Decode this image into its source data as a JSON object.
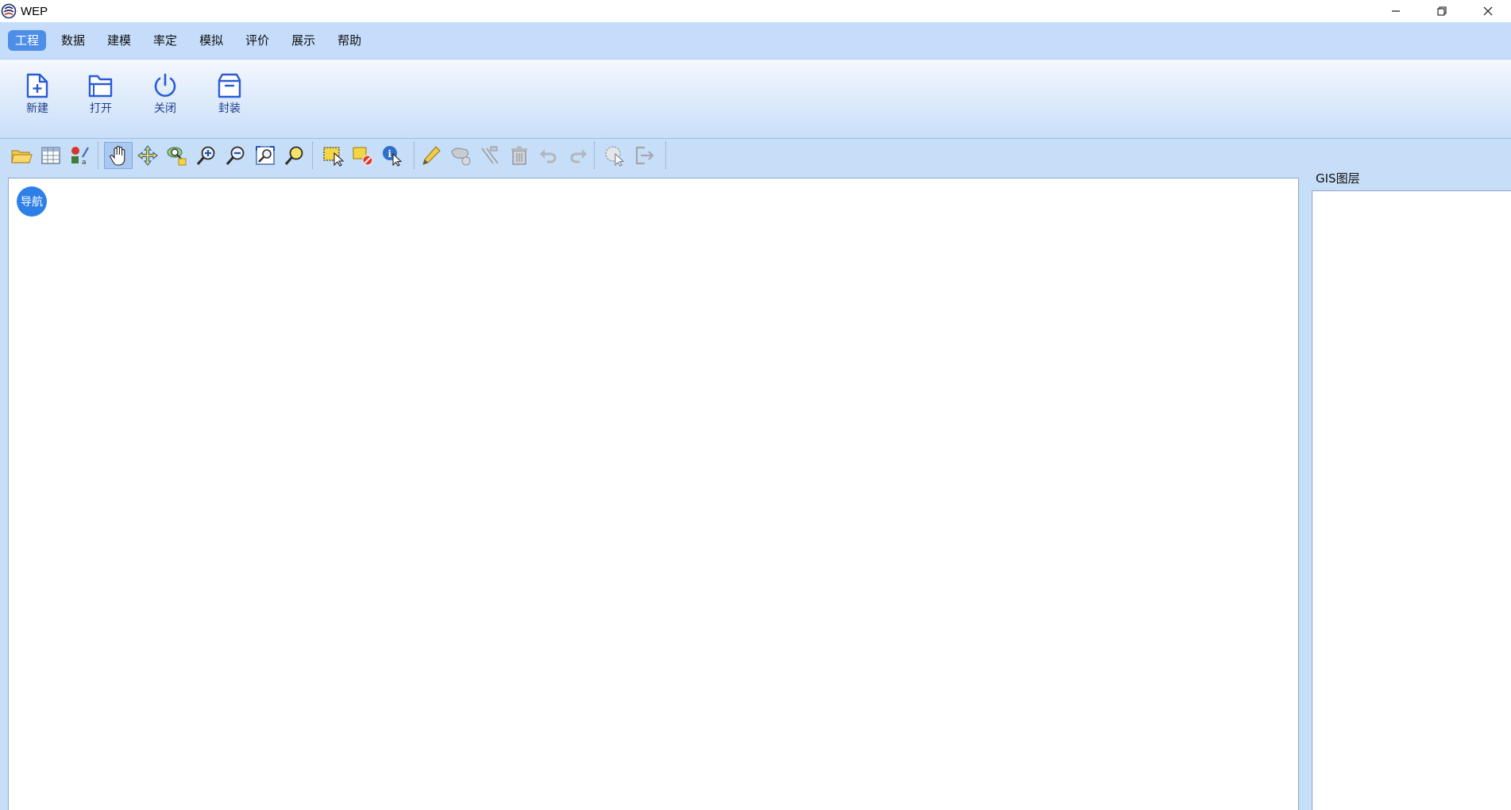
{
  "window": {
    "title": "WEP",
    "logo_icon": "wep-logo-icon",
    "controls": [
      "minimize-icon",
      "restore-icon",
      "close-icon"
    ]
  },
  "menu": {
    "items": [
      {
        "label": "工程",
        "active": true
      },
      {
        "label": "数据"
      },
      {
        "label": "建模"
      },
      {
        "label": "率定"
      },
      {
        "label": "模拟"
      },
      {
        "label": "评价"
      },
      {
        "label": "展示"
      },
      {
        "label": "帮助"
      }
    ]
  },
  "ribbon": {
    "buttons": [
      {
        "label": "新建",
        "icon": "new-file-icon"
      },
      {
        "label": "打开",
        "icon": "open-folder-icon"
      },
      {
        "label": "关闭",
        "icon": "power-icon"
      },
      {
        "label": "封装",
        "icon": "package-icon"
      }
    ]
  },
  "toolbar": {
    "groups": [
      [
        "open-layer-icon",
        "attribute-table-icon",
        "layer-style-icon"
      ],
      [
        "pan-icon",
        "pan-to-selection-icon",
        "zoom-to-layer-icon",
        "zoom-in-icon",
        "zoom-out-icon",
        "zoom-full-icon",
        "zoom-to-selection-icon"
      ],
      [
        "select-features-icon",
        "deselect-icon",
        "identify-icon"
      ],
      [
        "edit-pencil-icon",
        "add-feature-icon",
        "node-tool-icon",
        "delete-icon",
        "undo-icon",
        "redo-icon"
      ],
      [
        "measure-icon",
        "exit-icon"
      ]
    ],
    "pressed_tool": "pan-icon"
  },
  "map": {
    "nav_badge": "导航"
  },
  "layer_panel": {
    "title": "GIS图层"
  },
  "colors": {
    "menu_bg": "#c5ddfa",
    "menu_active": "#4d8ee9",
    "ribbon_label": "#1f3f8f",
    "nav_badge": "#2f7fe8"
  }
}
